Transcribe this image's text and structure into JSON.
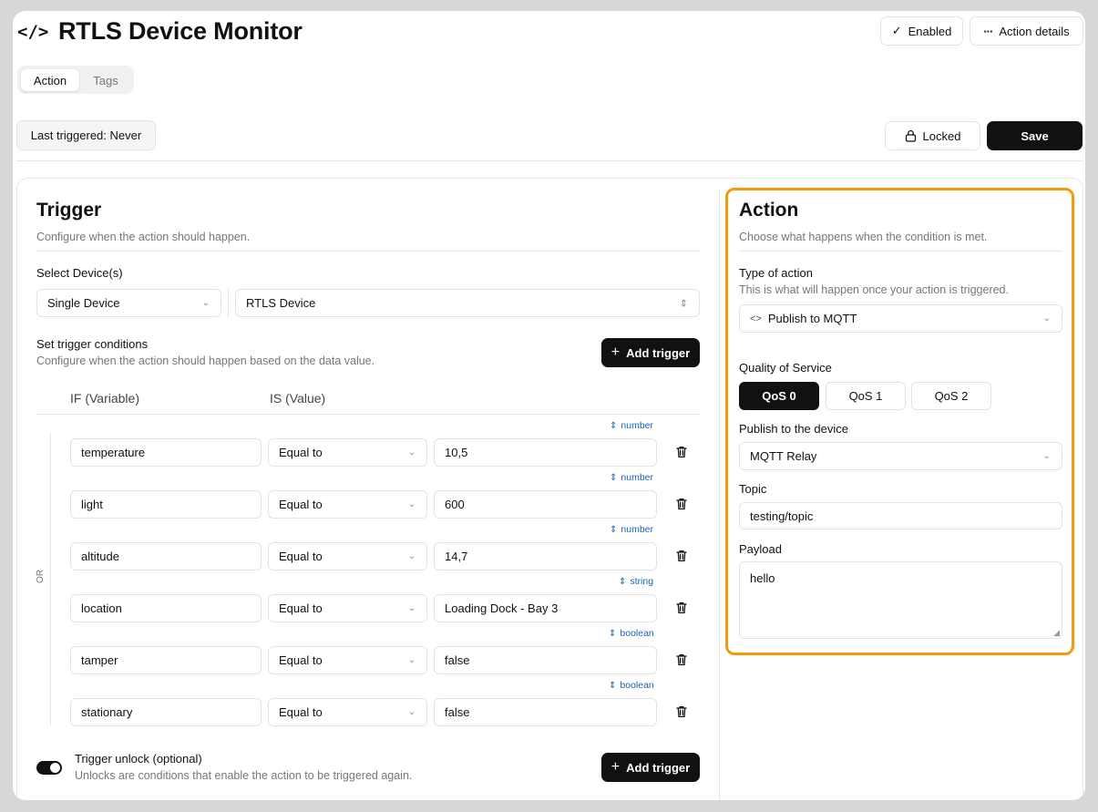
{
  "app": {
    "title": "RTLS Device Monitor",
    "icon": "code-icon"
  },
  "header": {
    "enabled_label": "Enabled",
    "action_details_label": "Action details"
  },
  "tabs": [
    {
      "label": "Action",
      "active": true
    },
    {
      "label": "Tags",
      "active": false
    }
  ],
  "toolbar": {
    "last_triggered": "Last triggered: Never",
    "locked_label": "Locked",
    "save_label": "Save"
  },
  "trigger": {
    "title": "Trigger",
    "subtitle": "Configure when the action should happen.",
    "select_device_label": "Select Device(s)",
    "device_mode": "Single Device",
    "device": "RTLS Device",
    "conditions_title": "Set trigger conditions",
    "conditions_subtitle": "Configure when the action should happen based on the data value.",
    "add_trigger_label": "Add trigger",
    "col_if": "IF (Variable)",
    "col_is": "IS (Value)",
    "or_label": "OR",
    "conditions": [
      {
        "variable": "temperature",
        "operator": "Equal to",
        "value": "10,5",
        "type": "number"
      },
      {
        "variable": "light",
        "operator": "Equal to",
        "value": "600",
        "type": "number"
      },
      {
        "variable": "altitude",
        "operator": "Equal to",
        "value": "14,7",
        "type": "number"
      },
      {
        "variable": "location",
        "operator": "Equal to",
        "value": "Loading Dock - Bay 3",
        "type": "string"
      },
      {
        "variable": "tamper",
        "operator": "Equal to",
        "value": "false",
        "type": "boolean"
      },
      {
        "variable": "stationary",
        "operator": "Equal to",
        "value": "false",
        "type": "boolean"
      }
    ],
    "unlock_title": "Trigger unlock (optional)",
    "unlock_subtitle": "Unlocks are conditions that enable the action to be triggered again.",
    "unlock_add_label": "Add trigger"
  },
  "action": {
    "title": "Action",
    "subtitle": "Choose what happens when the condition is met.",
    "type_label": "Type of action",
    "type_hint": "This is what will happen once your action is triggered.",
    "type_value": "Publish to MQTT",
    "qos_label": "Quality of Service",
    "qos_options": [
      "QoS 0",
      "QoS 1",
      "QoS 2"
    ],
    "qos_selected": "QoS 0",
    "publish_label": "Publish to the device",
    "publish_value": "MQTT Relay",
    "topic_label": "Topic",
    "topic_value": "testing/topic",
    "payload_label": "Payload",
    "payload_value": "hello",
    "highlight_color": "#f59a0a"
  }
}
